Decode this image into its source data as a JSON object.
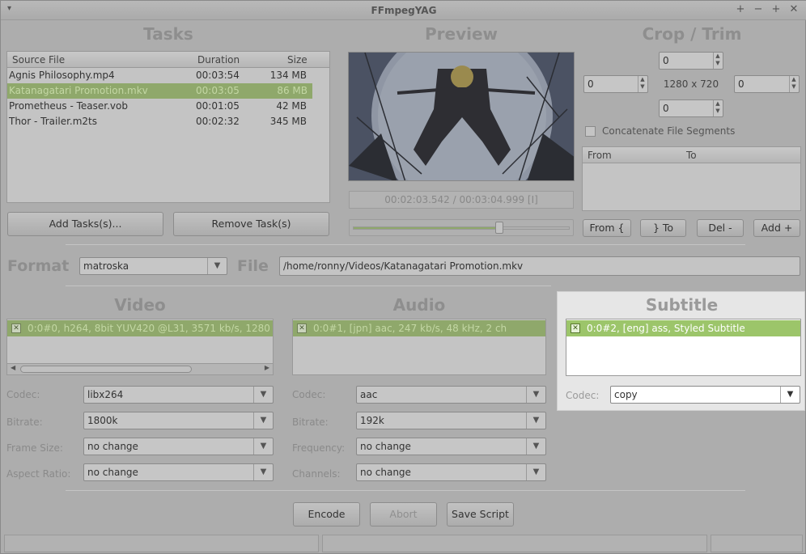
{
  "window": {
    "title": "FFmpegYAG"
  },
  "titlebar": {
    "menu_icon": "▾",
    "up": "+",
    "min": "−",
    "max": "+",
    "close": "✕"
  },
  "tasks": {
    "heading": "Tasks",
    "columns": [
      "Source File",
      "Duration",
      "Size"
    ],
    "rows": [
      {
        "file": "Agnis Philosophy.mp4",
        "duration": "00:03:54",
        "size": "134 MB"
      },
      {
        "file": "Katanagatari Promotion.mkv",
        "duration": "00:03:05",
        "size": "86 MB"
      },
      {
        "file": "Prometheus - Teaser.vob",
        "duration": "00:01:05",
        "size": "42 MB"
      },
      {
        "file": "Thor - Trailer.m2ts",
        "duration": "00:02:32",
        "size": "345 MB"
      }
    ],
    "add_button": "Add Tasks(s)...",
    "remove_button": "Remove Task(s)"
  },
  "preview": {
    "heading": "Preview",
    "time": "00:02:03.542 / 00:03:04.999 [I]",
    "position": 0.67
  },
  "crop": {
    "heading": "Crop / Trim",
    "top": "0",
    "left": "0",
    "right": "0",
    "bottom": "0",
    "resolution": "1280 x 720",
    "concat_label": "Concatenate File Segments",
    "col_from": "From",
    "col_to": "To",
    "from_button": "From {",
    "to_button": "} To",
    "del_button": "Del -",
    "add_button": "Add +"
  },
  "format": {
    "label": "Format",
    "value": "matroska"
  },
  "file": {
    "label": "File",
    "value": "/home/ronny/Videos/Katanagatari Promotion.mkv"
  },
  "video": {
    "heading": "Video",
    "stream": "0:0#0, h264, 8bit YUV420 @L31, 3571 kb/s, 1280",
    "codec_label": "Codec:",
    "codec": "libx264",
    "bitrate_label": "Bitrate:",
    "bitrate": "1800k",
    "framesize_label": "Frame Size:",
    "framesize": "no change",
    "aspect_label": "Aspect Ratio:",
    "aspect": "no change"
  },
  "audio": {
    "heading": "Audio",
    "stream": "0:0#1, [jpn] aac, 247 kb/s, 48 kHz, 2 ch",
    "codec_label": "Codec:",
    "codec": "aac",
    "bitrate_label": "Bitrate:",
    "bitrate": "192k",
    "frequency_label": "Frequency:",
    "frequency": "no change",
    "channels_label": "Channels:",
    "channels": "no change"
  },
  "subtitle": {
    "heading": "Subtitle",
    "stream": "0:0#2, [eng] ass, Styled Subtitle",
    "codec_label": "Codec:",
    "codec": "copy"
  },
  "actions": {
    "encode": "Encode",
    "abort": "Abort",
    "save_script": "Save Script"
  },
  "colors": {
    "highlight": "#9cc56a",
    "dim": "#adadad"
  }
}
